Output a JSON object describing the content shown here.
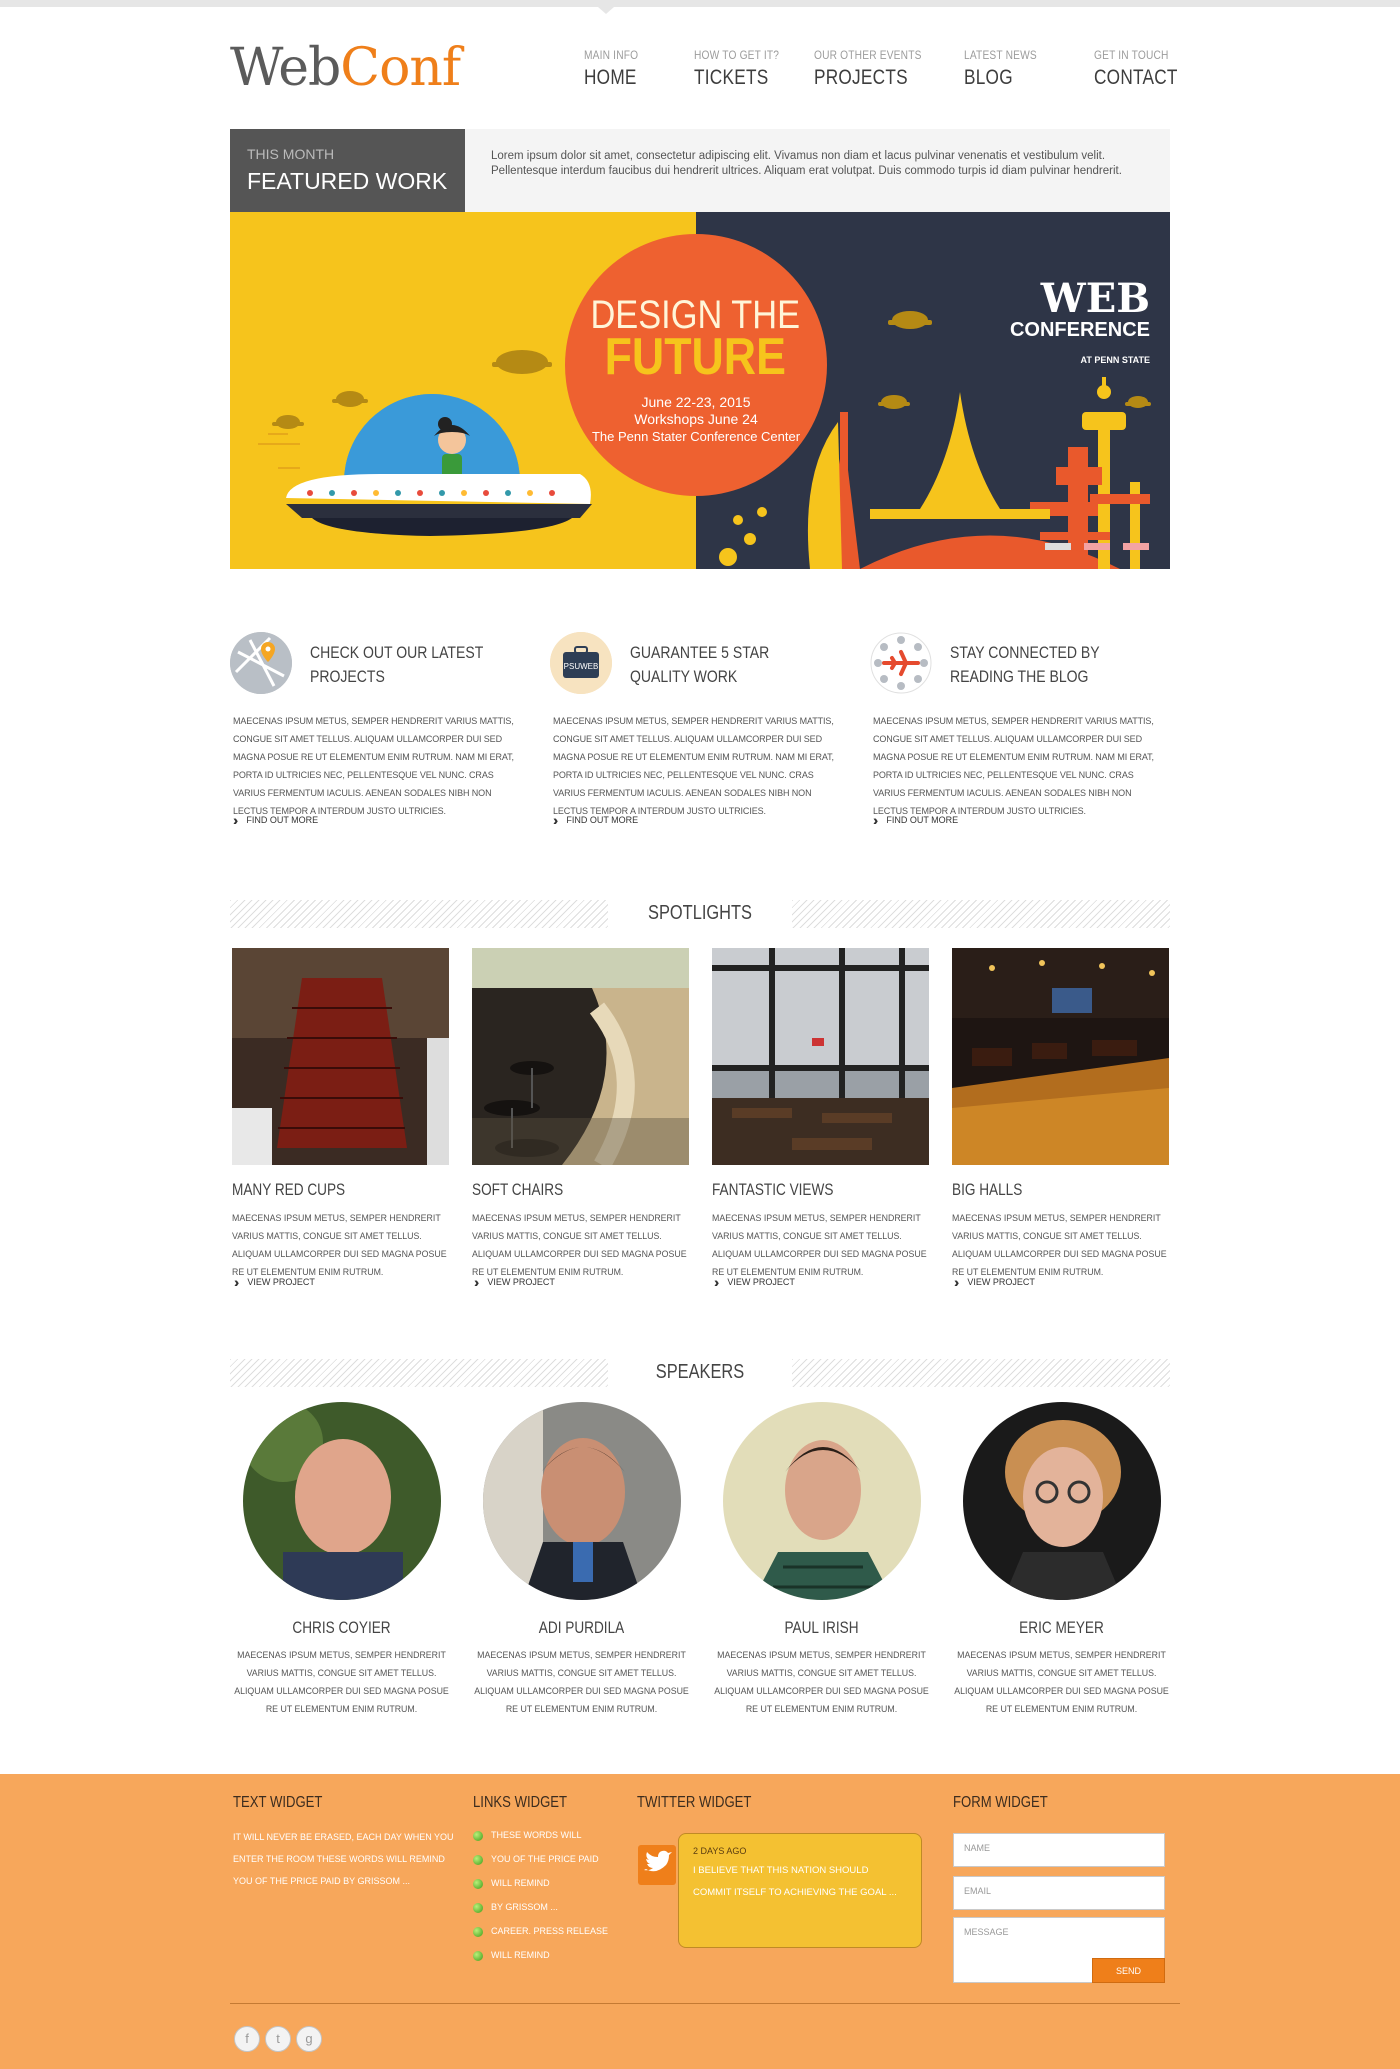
{
  "brand": {
    "part1": "Web",
    "part2": "Conf"
  },
  "nav": [
    {
      "sub": "Main info",
      "label": "Home"
    },
    {
      "sub": "How to get it?",
      "label": "Tickets"
    },
    {
      "sub": "Our other events",
      "label": "Projects"
    },
    {
      "sub": "Latest news",
      "label": "Blog"
    },
    {
      "sub": "Get in touch",
      "label": "Contact"
    }
  ],
  "featured": {
    "small": "This month",
    "title": "Featured Work",
    "text": "Lorem ipsum dolor sit amet, consectetur adipiscing elit. Vivamus non diam et lacus pulvinar venenatis et vestibulum velit. Pellentesque interdum faucibus dui hendrerit ultrices. Aliquam erat volutpat. Duis commodo turpis id diam pulvinar hendrerit."
  },
  "banner": {
    "line1": "DESIGN THE",
    "line2": "FUTURE",
    "date1": "June 22-23, 2015",
    "date2": "Workshops June 24",
    "venue": "The Penn Stater Conference Center",
    "web": "WEB",
    "conference": "CONFERENCE",
    "at": "AT PENN STATE"
  },
  "features": [
    {
      "title_line1": "Check out our latest",
      "title_line2": "projects",
      "text": "Maecenas ipsum metus, semper hendrerit varius mattis, congue sit amet tellus. Aliquam ullamcorper dui sed magna posue re ut elementum enim rutrum. Nam mi erat, porta id ultricies nec, pellentesque vel nunc. Cras varius fermentum iaculis. Aenean sodales nibh non lectus tempor a interdum justo ultricies.",
      "link": "Find out more"
    },
    {
      "title_line1": "Guarantee 5 star",
      "title_line2": "quality work",
      "badge": "PSUWEB",
      "text": "Maecenas ipsum metus, semper hendrerit varius mattis, congue sit amet tellus. Aliquam ullamcorper dui sed magna posue re ut elementum enim rutrum. Nam mi erat, porta id ultricies nec, pellentesque vel nunc. Cras varius fermentum iaculis. Aenean sodales nibh non lectus tempor a interdum justo ultricies.",
      "link": "Find out more"
    },
    {
      "title_line1": "Stay connected by",
      "title_line2": "reading the blog",
      "text": "Maecenas ipsum metus, semper hendrerit varius mattis, congue sit amet tellus. Aliquam ullamcorper dui sed magna posue re ut elementum enim rutrum. Nam mi erat, porta id ultricies nec, pellentesque vel nunc. Cras varius fermentum iaculis. Aenean sodales nibh non lectus tempor a interdum justo ultricies.",
      "link": "Find out more"
    }
  ],
  "spotlights": {
    "heading": "Spotlights",
    "items": [
      {
        "title": "Many red cups",
        "text": "Maecenas ipsum metus, semper hendrerit varius mattis, congue sit amet tellus. Aliquam ullamcorper dui sed magna posue re ut elementum enim rutrum.",
        "link": "View project"
      },
      {
        "title": "Soft chairs",
        "text": "Maecenas ipsum metus, semper hendrerit varius mattis, congue sit amet tellus. Aliquam ullamcorper dui sed magna posue re ut elementum enim rutrum.",
        "link": "View project"
      },
      {
        "title": "Fantastic views",
        "text": "Maecenas ipsum metus, semper hendrerit varius mattis, congue sit amet tellus. Aliquam ullamcorper dui sed magna posue re ut elementum enim rutrum.",
        "link": "View project"
      },
      {
        "title": "Big halls",
        "text": "Maecenas ipsum metus, semper hendrerit varius mattis, congue sit amet tellus. Aliquam ullamcorper dui sed magna posue re ut elementum enim rutrum.",
        "link": "View project"
      }
    ]
  },
  "speakers": {
    "heading": "Speakers",
    "items": [
      {
        "name": "Chris Coyier",
        "text": "Maecenas ipsum metus, semper hendrerit varius mattis, congue sit amet tellus. Aliquam ullamcorper dui sed magna posue re ut elementum enim rutrum."
      },
      {
        "name": "Adi Purdila",
        "text": "Maecenas ipsum metus, semper hendrerit varius mattis, congue sit amet tellus. Aliquam ullamcorper dui sed magna posue re ut elementum enim rutrum."
      },
      {
        "name": "Paul Irish",
        "text": "Maecenas ipsum metus, semper hendrerit varius mattis, congue sit amet tellus. Aliquam ullamcorper dui sed magna posue re ut elementum enim rutrum."
      },
      {
        "name": "Eric Meyer",
        "text": "Maecenas ipsum metus, semper hendrerit varius mattis, congue sit amet tellus. Aliquam ullamcorper dui sed magna posue re ut elementum enim rutrum."
      }
    ]
  },
  "footer": {
    "text_widget": {
      "title": "Text widget",
      "lines": [
        "It will never be erased, each day when you",
        "enter the room these words will remind",
        "you of the price paid by Grissom ..."
      ]
    },
    "links_widget": {
      "title": "Links widget",
      "items": [
        "These words will",
        "you of the price paid",
        "will remind",
        "by Grissom ...",
        "Career. Press release",
        "will remind"
      ]
    },
    "twitter_widget": {
      "title": "Twitter widget",
      "date": "2 days ago",
      "message": "I believe that this nation should commit itself to achieving the goal ..."
    },
    "form_widget": {
      "title": "Form widget",
      "name_placeholder": "Name",
      "email_placeholder": "Email",
      "message_placeholder": "Message",
      "send": "Send"
    },
    "social": [
      "f",
      "t",
      "g"
    ]
  },
  "colors": {
    "accent": "#ef7f1a",
    "footer_bg": "#f7a75b",
    "banner_yellow": "#f6c41c",
    "banner_navy": "#2e3547",
    "banner_red": "#ee6130"
  }
}
